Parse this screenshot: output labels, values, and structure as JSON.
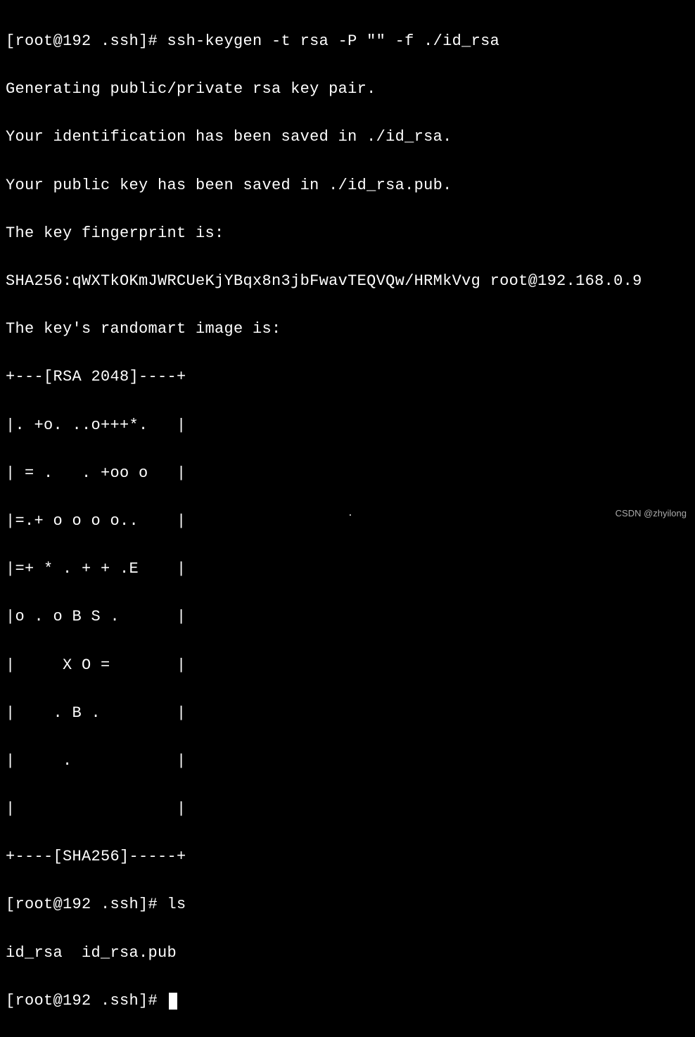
{
  "terminal": {
    "lines": [
      "[root@192 .ssh]# ssh-keygen -t rsa -P \"\" -f ./id_rsa",
      "Generating public/private rsa key pair.",
      "Your identification has been saved in ./id_rsa.",
      "Your public key has been saved in ./id_rsa.pub.",
      "The key fingerprint is:",
      "SHA256:qWXTkOKmJWRCUeKjYBqx8n3jbFwavTEQVQw/HRMkVvg root@192.168.0.9",
      "The key's randomart image is:",
      "+---[RSA 2048]----+",
      "|. +o. ..o+++*.   |",
      "| = .   . +oo o   |",
      "|=.+ o o o o..    |",
      "|=+ * . + + .E    |",
      "|o . o B S .      |",
      "|     X O =       |",
      "|    . B .        |",
      "|     .           |",
      "|                 |",
      "+----[SHA256]-----+",
      "[root@192 .ssh]# ls",
      "id_rsa  id_rsa.pub"
    ],
    "prompt": "[root@192 .ssh]# "
  },
  "watermark": "CSDN @zhyilong",
  "dot": "."
}
